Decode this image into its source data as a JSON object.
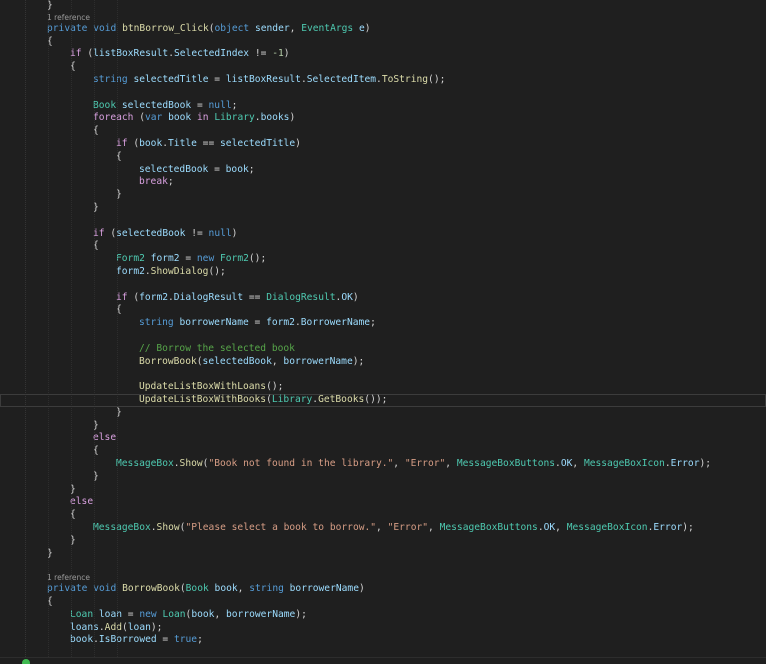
{
  "editor": {
    "lines": [
      {
        "kind": "code",
        "indent": 1,
        "tokens": [
          [
            "pn",
            "}"
          ]
        ]
      },
      {
        "kind": "lens",
        "indent": 1,
        "text": "1 reference"
      },
      {
        "kind": "code",
        "indent": 1,
        "tokens": [
          [
            "kw",
            "private"
          ],
          [
            "pn",
            " "
          ],
          [
            "kw",
            "void"
          ],
          [
            "pn",
            " "
          ],
          [
            "fn",
            "btnBorrow_Click"
          ],
          [
            "pn",
            "("
          ],
          [
            "kw",
            "object"
          ],
          [
            "pn",
            " "
          ],
          [
            "var",
            "sender"
          ],
          [
            "pn",
            ", "
          ],
          [
            "type",
            "EventArgs"
          ],
          [
            "pn",
            " "
          ],
          [
            "var",
            "e"
          ],
          [
            "pn",
            ")"
          ]
        ]
      },
      {
        "kind": "code",
        "indent": 1,
        "tokens": [
          [
            "pn",
            "{"
          ]
        ]
      },
      {
        "kind": "code",
        "indent": 2,
        "tokens": [
          [
            "ctl",
            "if"
          ],
          [
            "pn",
            " ("
          ],
          [
            "var",
            "listBoxResult"
          ],
          [
            "pn",
            "."
          ],
          [
            "var",
            "SelectedIndex"
          ],
          [
            "pn",
            " != "
          ],
          [
            "num",
            "-1"
          ],
          [
            "pn",
            ")"
          ]
        ]
      },
      {
        "kind": "code",
        "indent": 2,
        "tokens": [
          [
            "pn",
            "{"
          ]
        ]
      },
      {
        "kind": "code",
        "indent": 3,
        "tokens": [
          [
            "kw",
            "string"
          ],
          [
            "pn",
            " "
          ],
          [
            "var",
            "selectedTitle"
          ],
          [
            "pn",
            " = "
          ],
          [
            "var",
            "listBoxResult"
          ],
          [
            "pn",
            "."
          ],
          [
            "var",
            "SelectedItem"
          ],
          [
            "pn",
            "."
          ],
          [
            "fn",
            "ToString"
          ],
          [
            "pn",
            "();"
          ]
        ]
      },
      {
        "kind": "blank"
      },
      {
        "kind": "code",
        "indent": 3,
        "tokens": [
          [
            "type",
            "Book"
          ],
          [
            "pn",
            " "
          ],
          [
            "var",
            "selectedBook"
          ],
          [
            "pn",
            " = "
          ],
          [
            "kw",
            "null"
          ],
          [
            "pn",
            ";"
          ]
        ]
      },
      {
        "kind": "code",
        "indent": 3,
        "tokens": [
          [
            "ctl",
            "foreach"
          ],
          [
            "pn",
            " ("
          ],
          [
            "kw",
            "var"
          ],
          [
            "pn",
            " "
          ],
          [
            "var",
            "book"
          ],
          [
            "pn",
            " "
          ],
          [
            "ctl",
            "in"
          ],
          [
            "pn",
            " "
          ],
          [
            "type",
            "Library"
          ],
          [
            "pn",
            "."
          ],
          [
            "var",
            "books"
          ],
          [
            "pn",
            ")"
          ]
        ]
      },
      {
        "kind": "code",
        "indent": 3,
        "tokens": [
          [
            "pn",
            "{"
          ]
        ]
      },
      {
        "kind": "code",
        "indent": 4,
        "tokens": [
          [
            "ctl",
            "if"
          ],
          [
            "pn",
            " ("
          ],
          [
            "var",
            "book"
          ],
          [
            "pn",
            "."
          ],
          [
            "var",
            "Title"
          ],
          [
            "pn",
            " == "
          ],
          [
            "var",
            "selectedTitle"
          ],
          [
            "pn",
            ")"
          ]
        ]
      },
      {
        "kind": "code",
        "indent": 4,
        "tokens": [
          [
            "pn",
            "{"
          ]
        ]
      },
      {
        "kind": "code",
        "indent": 5,
        "tokens": [
          [
            "var",
            "selectedBook"
          ],
          [
            "pn",
            " = "
          ],
          [
            "var",
            "book"
          ],
          [
            "pn",
            ";"
          ]
        ]
      },
      {
        "kind": "code",
        "indent": 5,
        "tokens": [
          [
            "ctl",
            "break"
          ],
          [
            "pn",
            ";"
          ]
        ]
      },
      {
        "kind": "code",
        "indent": 4,
        "tokens": [
          [
            "pn",
            "}"
          ]
        ]
      },
      {
        "kind": "code",
        "indent": 3,
        "tokens": [
          [
            "pn",
            "}"
          ]
        ]
      },
      {
        "kind": "blank"
      },
      {
        "kind": "code",
        "indent": 3,
        "tokens": [
          [
            "ctl",
            "if"
          ],
          [
            "pn",
            " ("
          ],
          [
            "var",
            "selectedBook"
          ],
          [
            "pn",
            " != "
          ],
          [
            "kw",
            "null"
          ],
          [
            "pn",
            ")"
          ]
        ]
      },
      {
        "kind": "code",
        "indent": 3,
        "tokens": [
          [
            "pn",
            "{"
          ]
        ]
      },
      {
        "kind": "code",
        "indent": 4,
        "tokens": [
          [
            "type",
            "Form2"
          ],
          [
            "pn",
            " "
          ],
          [
            "var",
            "form2"
          ],
          [
            "pn",
            " = "
          ],
          [
            "kw",
            "new"
          ],
          [
            "pn",
            " "
          ],
          [
            "type",
            "Form2"
          ],
          [
            "pn",
            "();"
          ]
        ]
      },
      {
        "kind": "code",
        "indent": 4,
        "tokens": [
          [
            "var",
            "form2"
          ],
          [
            "pn",
            "."
          ],
          [
            "fn",
            "ShowDialog"
          ],
          [
            "pn",
            "();"
          ]
        ]
      },
      {
        "kind": "blank"
      },
      {
        "kind": "code",
        "indent": 4,
        "tokens": [
          [
            "ctl",
            "if"
          ],
          [
            "pn",
            " ("
          ],
          [
            "var",
            "form2"
          ],
          [
            "pn",
            "."
          ],
          [
            "var",
            "DialogResult"
          ],
          [
            "pn",
            " == "
          ],
          [
            "type",
            "DialogResult"
          ],
          [
            "pn",
            "."
          ],
          [
            "var",
            "OK"
          ],
          [
            "pn",
            ")"
          ]
        ]
      },
      {
        "kind": "code",
        "indent": 4,
        "tokens": [
          [
            "pn",
            "{"
          ]
        ]
      },
      {
        "kind": "code",
        "indent": 5,
        "tokens": [
          [
            "kw",
            "string"
          ],
          [
            "pn",
            " "
          ],
          [
            "var",
            "borrowerName"
          ],
          [
            "pn",
            " = "
          ],
          [
            "var",
            "form2"
          ],
          [
            "pn",
            "."
          ],
          [
            "var",
            "BorrowerName"
          ],
          [
            "pn",
            ";"
          ]
        ]
      },
      {
        "kind": "blank"
      },
      {
        "kind": "code",
        "indent": 5,
        "tokens": [
          [
            "cm",
            "// Borrow the selected book"
          ]
        ]
      },
      {
        "kind": "code",
        "indent": 5,
        "tokens": [
          [
            "fn",
            "BorrowBook"
          ],
          [
            "pn",
            "("
          ],
          [
            "var",
            "selectedBook"
          ],
          [
            "pn",
            ", "
          ],
          [
            "var",
            "borrowerName"
          ],
          [
            "pn",
            ");"
          ]
        ]
      },
      {
        "kind": "blank"
      },
      {
        "kind": "code",
        "indent": 5,
        "tokens": [
          [
            "fn",
            "UpdateListBoxWithLoans"
          ],
          [
            "pn",
            "();"
          ]
        ]
      },
      {
        "kind": "code",
        "indent": 5,
        "current": true,
        "tokens": [
          [
            "fn",
            "UpdateListBoxWithBooks"
          ],
          [
            "pn",
            "("
          ],
          [
            "type",
            "Library"
          ],
          [
            "pn",
            "."
          ],
          [
            "fn",
            "GetBooks"
          ],
          [
            "pn",
            "());"
          ]
        ]
      },
      {
        "kind": "code",
        "indent": 4,
        "tokens": [
          [
            "pn",
            "}"
          ]
        ]
      },
      {
        "kind": "code",
        "indent": 3,
        "tokens": [
          [
            "pn",
            "}"
          ]
        ]
      },
      {
        "kind": "code",
        "indent": 3,
        "tokens": [
          [
            "ctl",
            "else"
          ]
        ]
      },
      {
        "kind": "code",
        "indent": 3,
        "tokens": [
          [
            "pn",
            "{"
          ]
        ]
      },
      {
        "kind": "code",
        "indent": 4,
        "tokens": [
          [
            "type",
            "MessageBox"
          ],
          [
            "pn",
            "."
          ],
          [
            "fn",
            "Show"
          ],
          [
            "pn",
            "("
          ],
          [
            "str",
            "\"Book not found in the library.\""
          ],
          [
            "pn",
            ", "
          ],
          [
            "str",
            "\"Error\""
          ],
          [
            "pn",
            ", "
          ],
          [
            "type",
            "MessageBoxButtons"
          ],
          [
            "pn",
            "."
          ],
          [
            "var",
            "OK"
          ],
          [
            "pn",
            ", "
          ],
          [
            "type",
            "MessageBoxIcon"
          ],
          [
            "pn",
            "."
          ],
          [
            "var",
            "Error"
          ],
          [
            "pn",
            ");"
          ]
        ]
      },
      {
        "kind": "code",
        "indent": 3,
        "tokens": [
          [
            "pn",
            "}"
          ]
        ]
      },
      {
        "kind": "code",
        "indent": 2,
        "tokens": [
          [
            "pn",
            "}"
          ]
        ]
      },
      {
        "kind": "code",
        "indent": 2,
        "tokens": [
          [
            "ctl",
            "else"
          ]
        ]
      },
      {
        "kind": "code",
        "indent": 2,
        "tokens": [
          [
            "pn",
            "{"
          ]
        ]
      },
      {
        "kind": "code",
        "indent": 3,
        "tokens": [
          [
            "type",
            "MessageBox"
          ],
          [
            "pn",
            "."
          ],
          [
            "fn",
            "Show"
          ],
          [
            "pn",
            "("
          ],
          [
            "str",
            "\"Please select a book to borrow.\""
          ],
          [
            "pn",
            ", "
          ],
          [
            "str",
            "\"Error\""
          ],
          [
            "pn",
            ", "
          ],
          [
            "type",
            "MessageBoxButtons"
          ],
          [
            "pn",
            "."
          ],
          [
            "var",
            "OK"
          ],
          [
            "pn",
            ", "
          ],
          [
            "type",
            "MessageBoxIcon"
          ],
          [
            "pn",
            "."
          ],
          [
            "var",
            "Error"
          ],
          [
            "pn",
            ");"
          ]
        ]
      },
      {
        "kind": "code",
        "indent": 2,
        "tokens": [
          [
            "pn",
            "}"
          ]
        ]
      },
      {
        "kind": "code",
        "indent": 1,
        "tokens": [
          [
            "pn",
            "}"
          ]
        ]
      },
      {
        "kind": "blank"
      },
      {
        "kind": "lens",
        "indent": 1,
        "text": "1 reference"
      },
      {
        "kind": "code",
        "indent": 1,
        "tokens": [
          [
            "kw",
            "private"
          ],
          [
            "pn",
            " "
          ],
          [
            "kw",
            "void"
          ],
          [
            "pn",
            " "
          ],
          [
            "fn",
            "BorrowBook"
          ],
          [
            "pn",
            "("
          ],
          [
            "type",
            "Book"
          ],
          [
            "pn",
            " "
          ],
          [
            "var",
            "book"
          ],
          [
            "pn",
            ", "
          ],
          [
            "kw",
            "string"
          ],
          [
            "pn",
            " "
          ],
          [
            "var",
            "borrowerName"
          ],
          [
            "pn",
            ")"
          ]
        ]
      },
      {
        "kind": "code",
        "indent": 1,
        "tokens": [
          [
            "pn",
            "{"
          ]
        ]
      },
      {
        "kind": "code",
        "indent": 2,
        "tokens": [
          [
            "type",
            "Loan"
          ],
          [
            "pn",
            " "
          ],
          [
            "var",
            "loan"
          ],
          [
            "pn",
            " = "
          ],
          [
            "kw",
            "new"
          ],
          [
            "pn",
            " "
          ],
          [
            "type",
            "Loan"
          ],
          [
            "pn",
            "("
          ],
          [
            "var",
            "book"
          ],
          [
            "pn",
            ", "
          ],
          [
            "var",
            "borrowerName"
          ],
          [
            "pn",
            ");"
          ]
        ]
      },
      {
        "kind": "code",
        "indent": 2,
        "tokens": [
          [
            "var",
            "loans"
          ],
          [
            "pn",
            "."
          ],
          [
            "fn",
            "Add"
          ],
          [
            "pn",
            "("
          ],
          [
            "var",
            "loan"
          ],
          [
            "pn",
            ");"
          ]
        ]
      },
      {
        "kind": "code",
        "indent": 2,
        "tokens": [
          [
            "var",
            "book"
          ],
          [
            "pn",
            "."
          ],
          [
            "var",
            "IsBorrowed"
          ],
          [
            "pn",
            " = "
          ],
          [
            "kw",
            "true"
          ],
          [
            "pn",
            ";"
          ]
        ]
      }
    ]
  }
}
